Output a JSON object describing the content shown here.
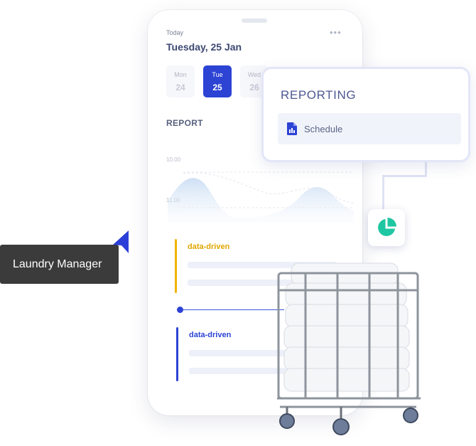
{
  "phone": {
    "today_label": "Today",
    "date_title": "Tuesday, 25 Jan",
    "menu_icon": "more-dots-icon",
    "days": [
      {
        "name": "Mon",
        "num": "24",
        "active": false
      },
      {
        "name": "Tue",
        "num": "25",
        "active": true
      },
      {
        "name": "Wed",
        "num": "26",
        "active": false
      }
    ],
    "report_label": "REPORT",
    "chart_ticks": [
      "10.00",
      "11.00"
    ],
    "items": [
      {
        "title": "data-driven",
        "color": "#f0b400"
      },
      {
        "title": "data-driven",
        "color": "#2c43d4"
      }
    ]
  },
  "reporting_card": {
    "title": "REPORTING",
    "row_label": "Schedule",
    "row_icon": "document-chart-icon"
  },
  "pie_tile": {
    "icon": "pie-chart-icon",
    "color": "#1fc6a2"
  },
  "tag": {
    "label": "Laundry Manager",
    "pointer_icon": "cursor-pointer-icon"
  },
  "cart": {
    "icon": "laundry-cart-image"
  },
  "colors": {
    "accent": "#2c43d4",
    "teal": "#1fc6a2",
    "yellow": "#f0b400",
    "tag_bg": "#3b3b3b"
  }
}
